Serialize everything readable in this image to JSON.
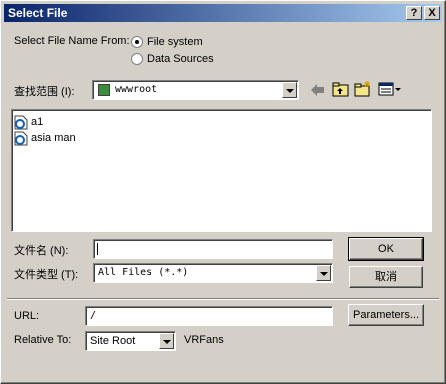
{
  "window": {
    "title": "Select File"
  },
  "title_buttons": {
    "help": "?",
    "close": "X"
  },
  "source": {
    "label": "Select File Name From:",
    "options": [
      "File system",
      "Data Sources"
    ],
    "selected": "File system"
  },
  "lookin": {
    "label": "查找范围 (I):",
    "value": "wwwroot"
  },
  "files": [
    {
      "name": "a1"
    },
    {
      "name": "asia man"
    }
  ],
  "filename": {
    "label": "文件名 (N):",
    "value": ""
  },
  "filetype": {
    "label": "文件类型 (T):",
    "value": "All Files (*.*)"
  },
  "buttons": {
    "ok": "OK",
    "cancel": "取消",
    "parameters": "Parameters..."
  },
  "url": {
    "label": "URL:",
    "value": "/"
  },
  "relative": {
    "label": "Relative To:",
    "value": "Site Root",
    "extra": "VRFans"
  },
  "colors": {
    "title_start": "#0a246a",
    "title_end": "#a6caf0",
    "face": "#d4d0c8"
  }
}
